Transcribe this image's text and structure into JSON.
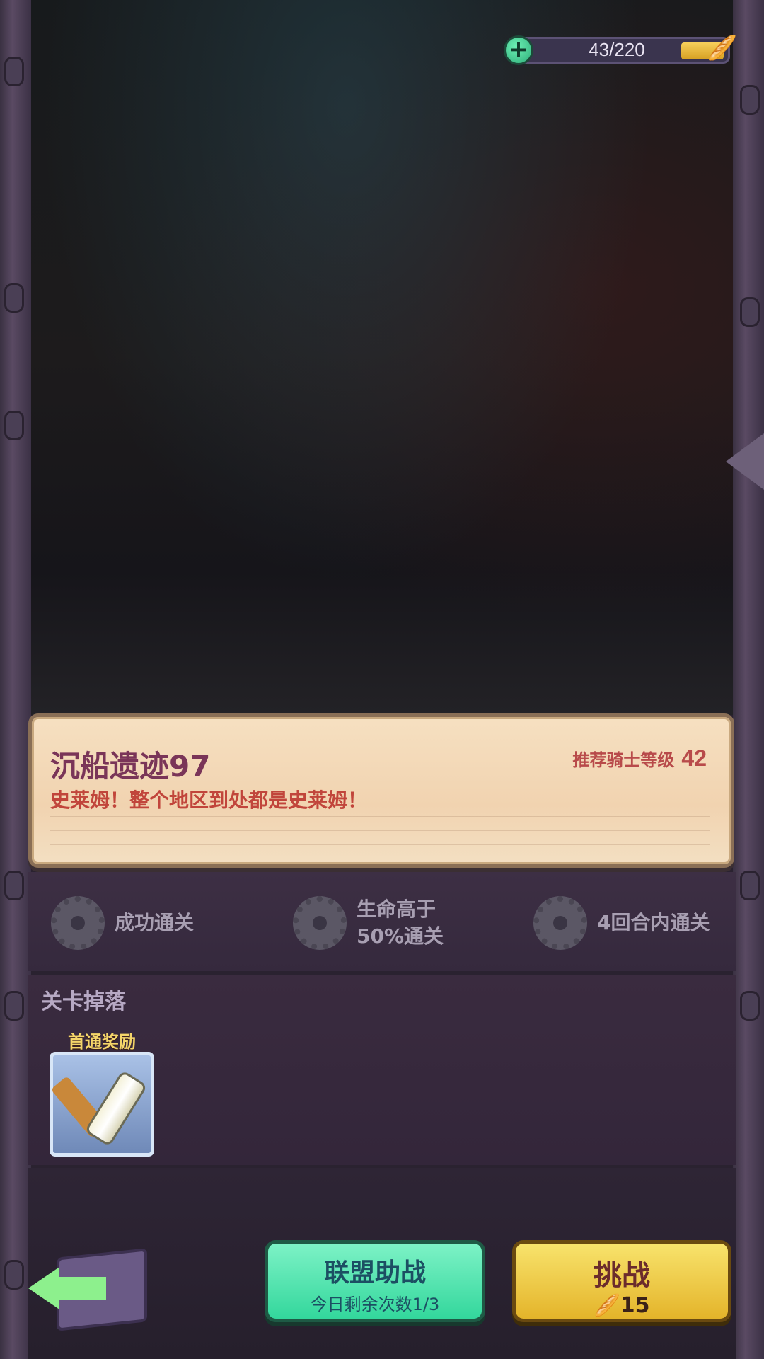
{
  "energy": {
    "value": "43/220",
    "fill_fraction": 0.2,
    "plus_icon": "plus-icon",
    "currency_icon": "bread-icon"
  },
  "stage": {
    "title": "沉船遗迹97",
    "recommended_label": "推荐骑士等级",
    "recommended_level": "42",
    "description": "史莱姆！整个地区到处都是史莱姆！"
  },
  "objectives": [
    {
      "text": "成功通关"
    },
    {
      "text": "生命高于50%通关"
    },
    {
      "text": "4回合内通关"
    }
  ],
  "drops": {
    "label": "关卡掉落",
    "first_clear_tag": "首通奖励"
  },
  "buttons": {
    "ally_label": "联盟助战",
    "ally_sub": "今日剩余次数1/3",
    "challenge_label": "挑战",
    "challenge_cost": "15"
  },
  "colors": {
    "title": "#7a3558",
    "description": "#c1453b",
    "ally": "#33d79c",
    "challenge": "#e4b42a"
  }
}
